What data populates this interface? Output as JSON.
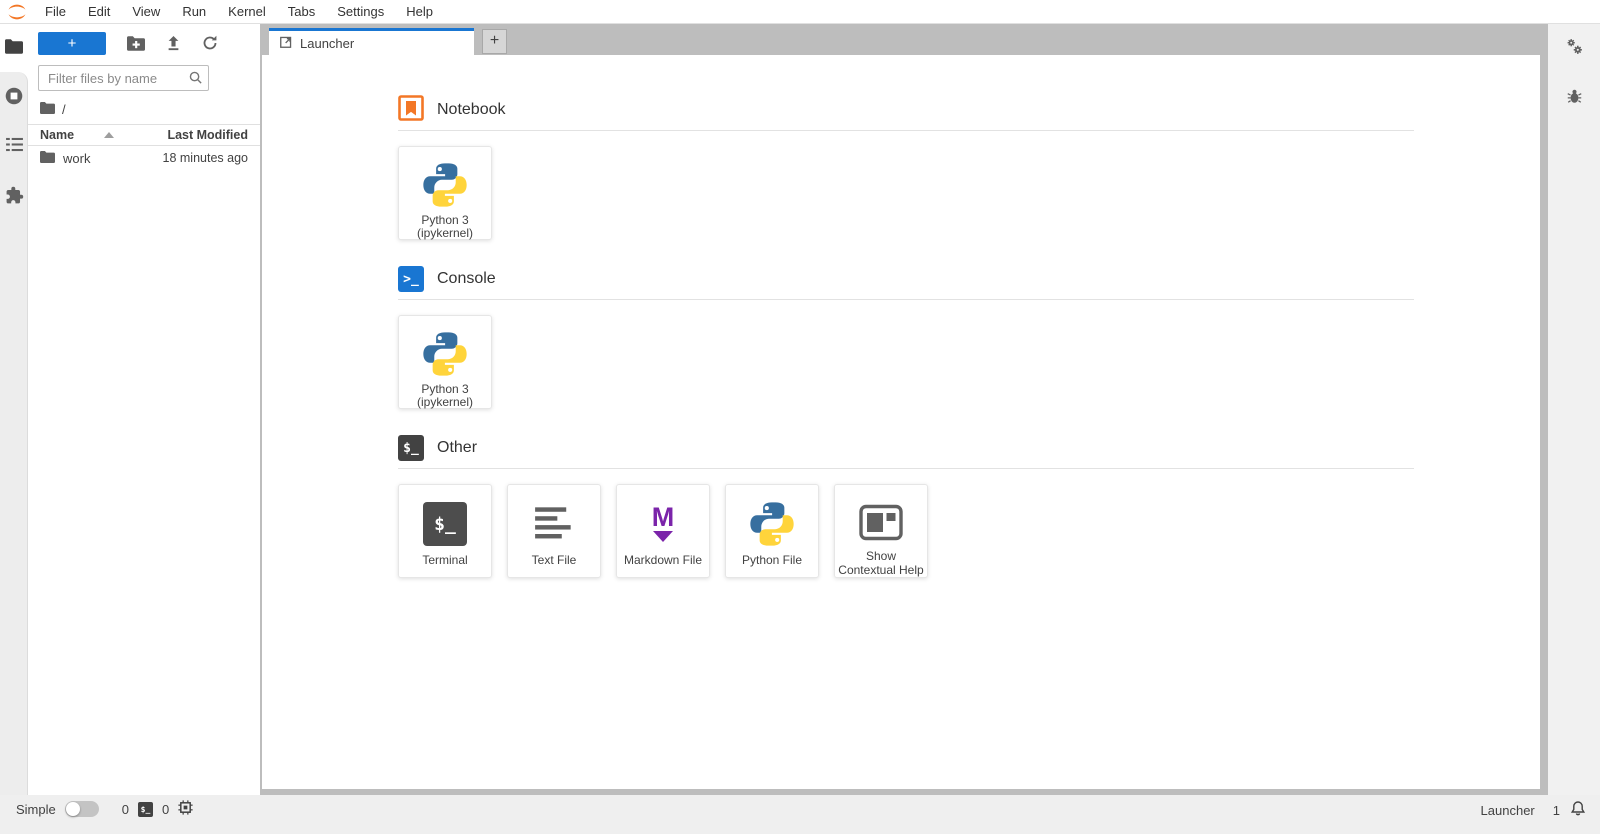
{
  "menu": {
    "items": [
      "File",
      "Edit",
      "View",
      "Run",
      "Kernel",
      "Tabs",
      "Settings",
      "Help"
    ]
  },
  "file_browser": {
    "new_launcher_button": "+",
    "filter_placeholder": "Filter files by name",
    "breadcrumb_root": "/",
    "header": {
      "name": "Name",
      "modified": "Last Modified"
    },
    "rows": [
      {
        "name": "work",
        "modified": "18 minutes ago"
      }
    ]
  },
  "dock": {
    "tabs": [
      {
        "label": "Launcher",
        "active": true
      }
    ],
    "add_tab_label": "+"
  },
  "launcher": {
    "sections": [
      {
        "title": "Notebook",
        "cards": [
          {
            "label": "Python 3 (ipykernel)",
            "icon": "python-icon"
          }
        ]
      },
      {
        "title": "Console",
        "cards": [
          {
            "label": "Python 3 (ipykernel)",
            "icon": "python-icon"
          }
        ]
      },
      {
        "title": "Other",
        "cards": [
          {
            "label": "Terminal",
            "icon": "terminal-icon"
          },
          {
            "label": "Text File",
            "icon": "text-file-icon"
          },
          {
            "label": "Markdown File",
            "icon": "markdown-icon"
          },
          {
            "label": "Python File",
            "icon": "python-icon"
          },
          {
            "label": "Show Contextual Help",
            "icon": "contextual-help-icon"
          }
        ]
      }
    ]
  },
  "glyphs": {
    "plus": "+",
    "console_prompt": ">_",
    "shell_prompt": "$_",
    "markdown_m": "M"
  },
  "status_bar": {
    "mode_label": "Simple",
    "terminals_count": "0",
    "kernels_count": "0",
    "current_activity": "Launcher",
    "notifications_count": "1"
  },
  "colors": {
    "brand_orange": "#f37726",
    "accent_blue": "#1976d2",
    "markdown_purple": "#7b24aa",
    "python_blue": "#376f9f",
    "python_yellow": "#ffd43b",
    "icon_gray": "#616161",
    "dock_border_gray": "#bdbdbd"
  }
}
